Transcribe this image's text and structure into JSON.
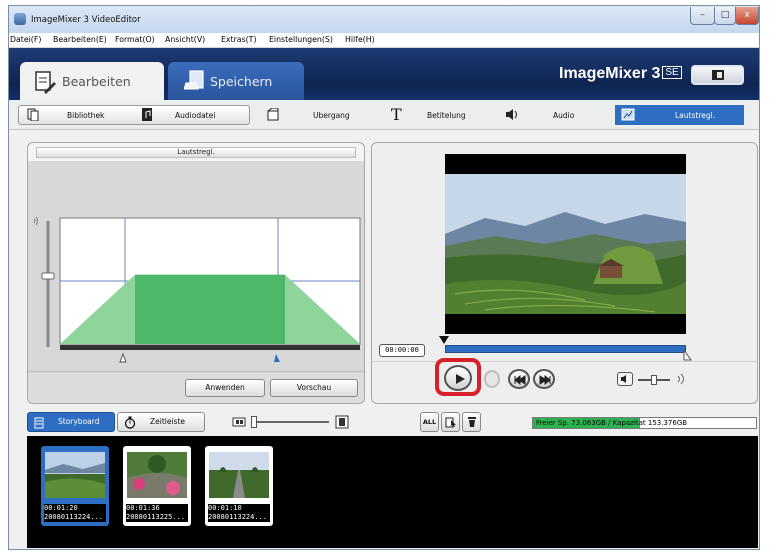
{
  "window": {
    "title": "ImageMixer 3 VideoEditor",
    "minimize_glyph": "–",
    "maximize_glyph": "□",
    "close_glyph": "x"
  },
  "menu": [
    "Datei(F)",
    "Bearbeiten(E)",
    "Format(O)",
    "Ansicht(V)",
    "Extras(T)",
    "Einstellungen(S)",
    "Hilfe(H)"
  ],
  "header": {
    "tabs": [
      {
        "label": "Bearbeiten",
        "active": true,
        "icon": "edit-document-icon"
      },
      {
        "label": "Speichern",
        "active": false,
        "icon": "save-document-icon"
      }
    ],
    "brand": "ImageMixer 3",
    "brand_edition": "SE"
  },
  "toolbar": {
    "library": "Bibliothek",
    "audiofile": "Audiodatei",
    "transition": "Ubergang",
    "titling": "Betitelung",
    "titling_glyph": "T",
    "audio": "Audio",
    "volume": "Lautstregl."
  },
  "volume_panel": {
    "title": "Lautstregl.",
    "apply_label": "Anwenden",
    "preview_label": "Vorschau",
    "envelope": {
      "fade_in_end": 0.25,
      "fade_out_start": 0.75,
      "level": 0.55
    }
  },
  "player": {
    "timecode": "00:00:00",
    "play_icon": "play-icon",
    "prev_icon": "skip-back-icon",
    "next_icon": "skip-forward-icon",
    "volume_icon": "speaker-icon",
    "volume_level": 0.5
  },
  "bottom": {
    "storyboard_tab": "Storyboard",
    "timeline_tab": "Zeitleiste",
    "all_label": "ALL",
    "free_space": "Freier Sp. 73.063GB / Kapazitat 153.376GB",
    "free_space_used_fraction": 0.48
  },
  "clips": [
    {
      "duration": "00:01:20",
      "name": "20080113224...",
      "selected": true
    },
    {
      "duration": "00:01:36",
      "name": "20080113225...",
      "selected": false
    },
    {
      "duration": "00:01:10",
      "name": "20080113224...",
      "selected": false
    }
  ],
  "colors": {
    "accent": "#2d6ec2",
    "header": "#0f2450",
    "envelope_fill": "#8fd49a",
    "envelope_fill_dark": "#4db86a",
    "free_space": "#2fb352",
    "highlight": "#d8202a"
  }
}
